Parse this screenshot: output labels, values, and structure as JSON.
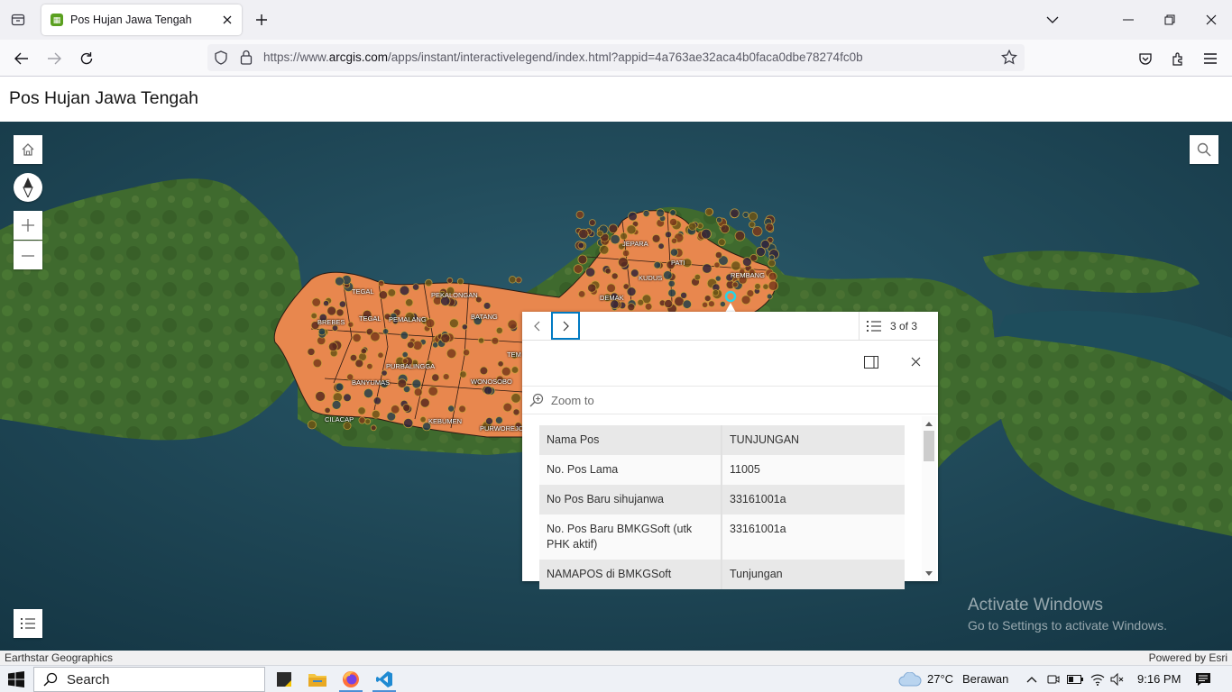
{
  "browser": {
    "tab_title": "Pos Hujan Jawa Tengah",
    "url_prefix": "https://www.",
    "url_domain": "arcgis.com",
    "url_rest": "/apps/instant/interactivelegend/index.html?appid=4a763ae32aca4b0faca0dbe78274fc0b"
  },
  "app": {
    "title": "Pos Hujan Jawa Tengah"
  },
  "map": {
    "labels": [
      {
        "text": "TEGAL"
      },
      {
        "text": "PEKALONGAN"
      },
      {
        "text": "BREBES"
      },
      {
        "text": "TEGAL"
      },
      {
        "text": "PEMALANG"
      },
      {
        "text": "BATANG"
      },
      {
        "text": "PURBALINGGA"
      },
      {
        "text": "BANYUMAS"
      },
      {
        "text": "WONOSOBO"
      },
      {
        "text": "CILACAP"
      },
      {
        "text": "KEBUMEN"
      },
      {
        "text": "PURWOREJO"
      },
      {
        "text": "JEPARA"
      },
      {
        "text": "PATI"
      },
      {
        "text": "KUDUS"
      },
      {
        "text": "REMBANG"
      },
      {
        "text": "DEMAK"
      },
      {
        "text": "TEM"
      }
    ],
    "attribution_left": "Earthstar Geographics",
    "attribution_right": "Powered by Esri",
    "colors": {
      "region_fill": "#e8874e",
      "sea": "#1f4a5a"
    }
  },
  "popup": {
    "count_label": "3 of 3",
    "zoom_to_label": "Zoom to",
    "rows": [
      {
        "key": "Nama Pos",
        "value": "TUNJUNGAN"
      },
      {
        "key": "No. Pos Lama",
        "value": "11005"
      },
      {
        "key": "No Pos Baru sihujanwa",
        "value": "33161001a"
      },
      {
        "key": "No. Pos Baru BMKGSoft (utk PHK aktif)",
        "value": "33161001a"
      },
      {
        "key": "NAMAPOS di BMKGSoft",
        "value": "Tunjungan"
      }
    ]
  },
  "watermark": {
    "line1": "Activate Windows",
    "line2": "Go to Settings to activate Windows."
  },
  "taskbar": {
    "search_label": "Search",
    "weather_temp": "27°C",
    "weather_desc": "Berawan",
    "time": "9:16 PM"
  }
}
